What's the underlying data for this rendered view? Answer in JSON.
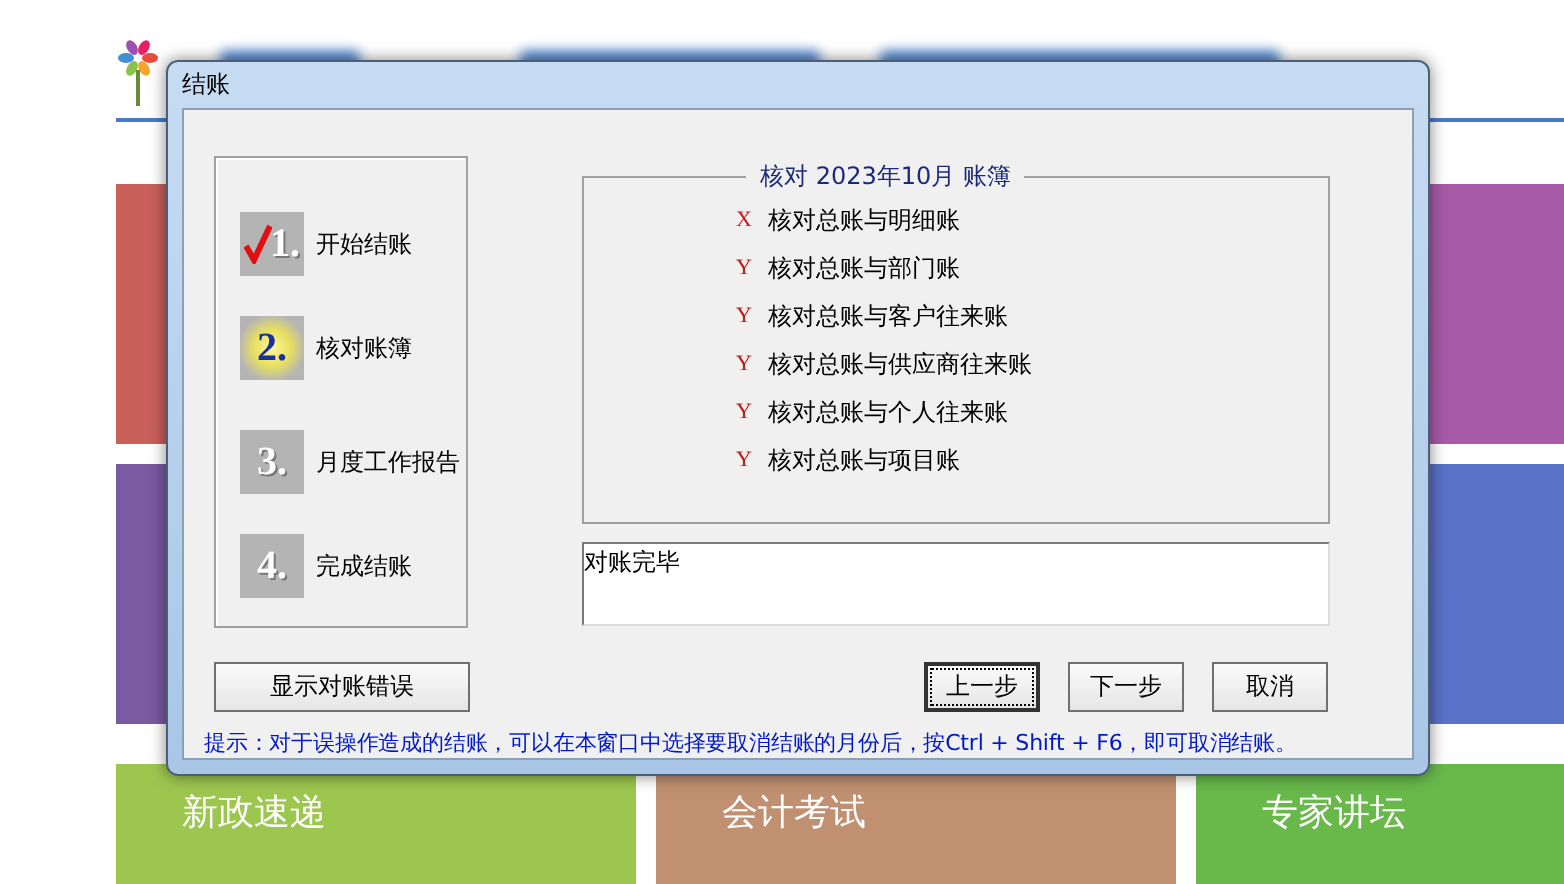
{
  "dialog": {
    "title": "结账",
    "steps": [
      {
        "number": "1.",
        "label": "开始结账",
        "done": true,
        "current": false
      },
      {
        "number": "2.",
        "label": "核对账簿",
        "done": false,
        "current": true
      },
      {
        "number": "3.",
        "label": "月度工作报告",
        "done": false,
        "current": false
      },
      {
        "number": "4.",
        "label": "完成结账",
        "done": false,
        "current": false
      }
    ],
    "check_group": {
      "title": "核对 2023年10月 账簿",
      "items": [
        {
          "mark": "X",
          "label": "核对总账与明细账"
        },
        {
          "mark": "Y",
          "label": "核对总账与部门账"
        },
        {
          "mark": "Y",
          "label": "核对总账与客户往来账"
        },
        {
          "mark": "Y",
          "label": "核对总账与供应商往来账"
        },
        {
          "mark": "Y",
          "label": "核对总账与个人往来账"
        },
        {
          "mark": "Y",
          "label": "核对总账与项目账"
        }
      ]
    },
    "result_text": "对账完毕",
    "error_button": {
      "label": "显示对账错误",
      "focused": false
    },
    "nav_buttons": [
      {
        "label": "上一步",
        "focused": true
      },
      {
        "label": "下一步",
        "focused": false
      },
      {
        "label": "取消",
        "focused": false
      }
    ],
    "hint": "提示：对于误操作造成的结账，可以在本窗口中选择要取消结账的月份后，按Ctrl + Shift + F6，即可取消结账。"
  },
  "background": {
    "tiles": [
      {
        "label": "新政速递"
      },
      {
        "label": "会计考试"
      },
      {
        "label": "专家讲坛"
      }
    ]
  }
}
